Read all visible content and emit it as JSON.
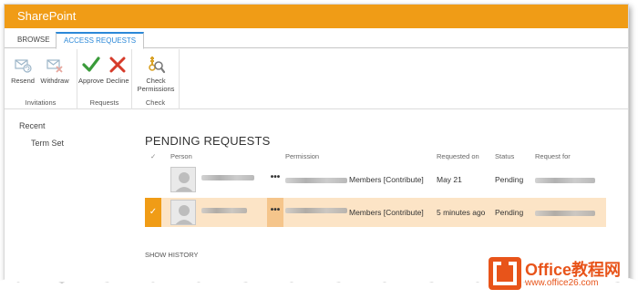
{
  "suitebar": {
    "title": "SharePoint"
  },
  "tabs": [
    {
      "label": "BROWSE"
    },
    {
      "label": "ACCESS REQUESTS"
    }
  ],
  "ribbon": {
    "groups": [
      {
        "name": "Invitations",
        "buttons": [
          {
            "label": "Resend"
          },
          {
            "label": "Withdraw"
          }
        ]
      },
      {
        "name": "Requests",
        "buttons": [
          {
            "label": "Approve"
          },
          {
            "label": "Decline"
          }
        ]
      },
      {
        "name": "Check",
        "buttons": [
          {
            "label_line1": "Check",
            "label_line2": "Permissions"
          }
        ]
      }
    ]
  },
  "leftnav": {
    "items": [
      {
        "label": "Recent"
      },
      {
        "label": "Term Set"
      }
    ]
  },
  "page": {
    "title": "PENDING REQUESTS",
    "show_history": "SHOW HISTORY"
  },
  "table": {
    "headers": {
      "check": "✓",
      "person": "Person",
      "permission": "Permission",
      "requested_on": "Requested on",
      "status": "Status",
      "request_for": "Request for"
    },
    "rows": [
      {
        "permission": "Members [Contribute]",
        "requested_on": "May 21",
        "status": "Pending",
        "menu": "•••",
        "selected": false
      },
      {
        "permission": "Members [Contribute]",
        "requested_on": "5 minutes ago",
        "status": "Pending",
        "menu": "•••",
        "selected": true,
        "check": "✓"
      }
    ]
  },
  "watermark": {
    "brand": "Office教程网",
    "url": "www.office26.com"
  },
  "colors": {
    "accent": "#f09c16",
    "tab_blue": "#2b88d8",
    "approve_green": "#3a9b3a",
    "decline_red": "#d63b2a",
    "selected_row": "#fce4c6"
  },
  "icons": [
    "resend-icon",
    "withdraw-icon",
    "approve-check-icon",
    "decline-x-icon",
    "check-permissions-icon",
    "office-logo-icon"
  ]
}
